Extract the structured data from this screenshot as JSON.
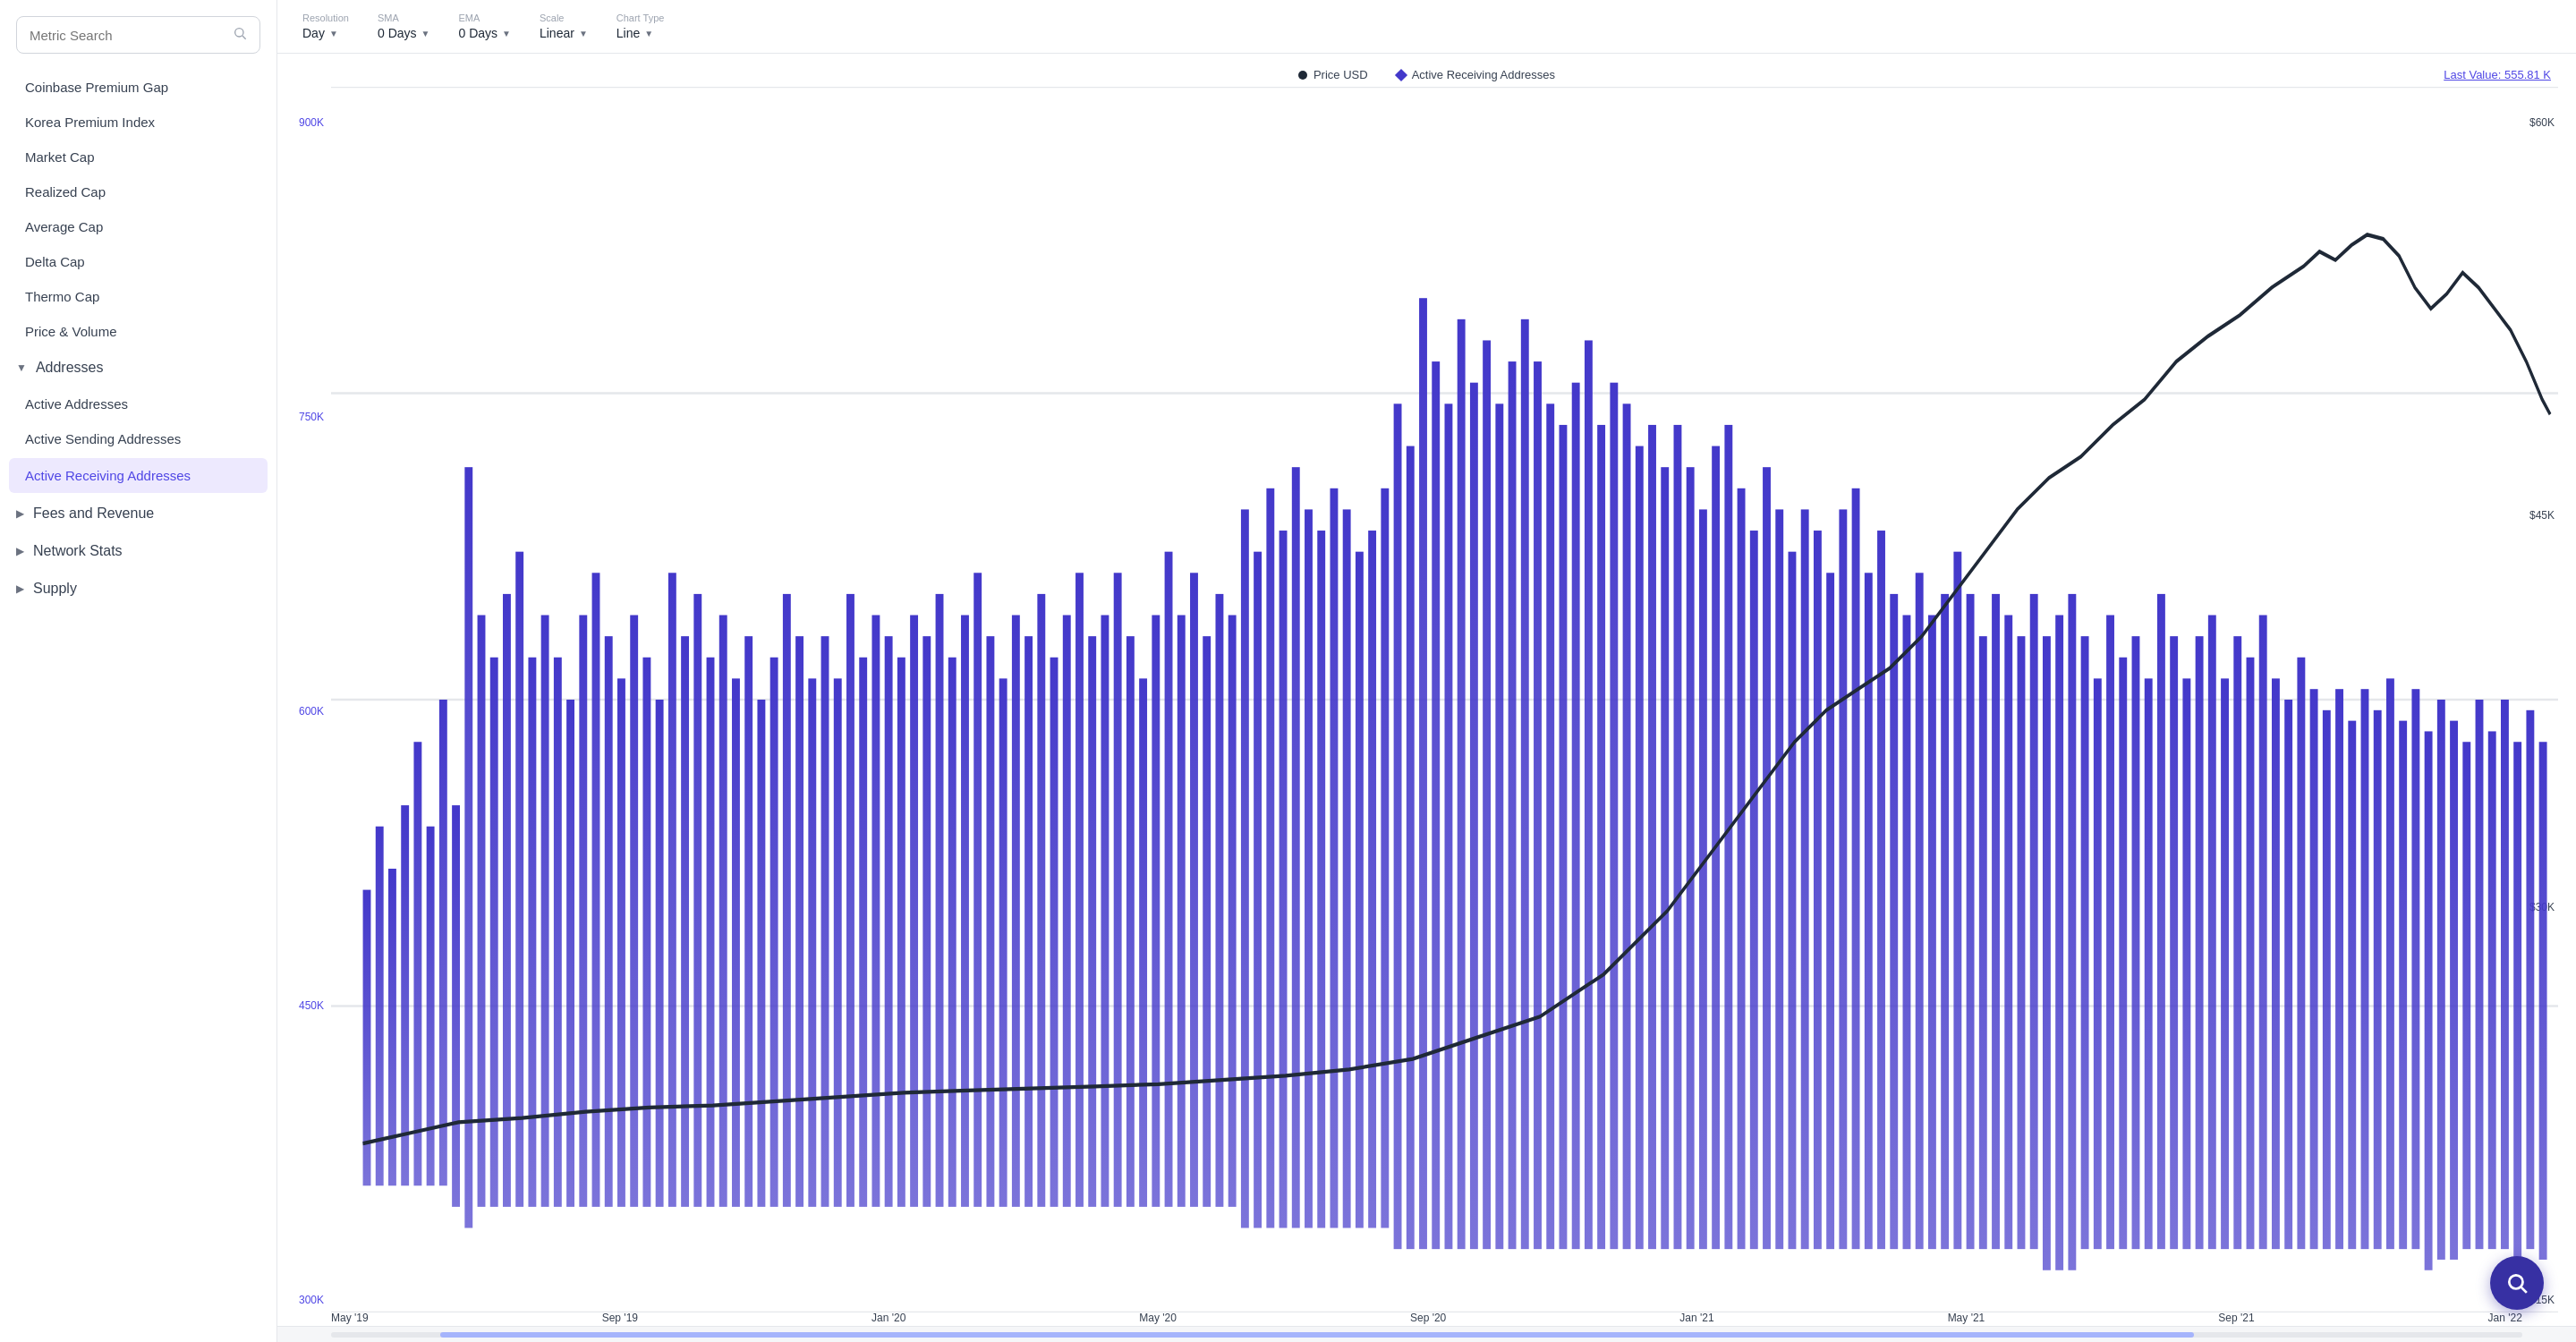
{
  "sidebar": {
    "search_placeholder": "Metric Search",
    "nav_items": [
      {
        "label": "Coinbase Premium Gap",
        "id": "coinbase-premium-gap"
      },
      {
        "label": "Korea Premium Index",
        "id": "korea-premium-index"
      },
      {
        "label": "Market Cap",
        "id": "market-cap"
      },
      {
        "label": "Realized Cap",
        "id": "realized-cap"
      },
      {
        "label": "Average Cap",
        "id": "average-cap"
      },
      {
        "label": "Delta Cap",
        "id": "delta-cap"
      },
      {
        "label": "Thermo Cap",
        "id": "thermo-cap"
      },
      {
        "label": "Price & Volume",
        "id": "price-volume"
      }
    ],
    "sections": [
      {
        "label": "Addresses",
        "id": "addresses",
        "expanded": true,
        "children": [
          {
            "label": "Active Addresses",
            "id": "active-addresses",
            "active": false
          },
          {
            "label": "Active Sending Addresses",
            "id": "active-sending-addresses",
            "active": false
          },
          {
            "label": "Active Receiving Addresses",
            "id": "active-receiving-addresses",
            "active": true
          }
        ]
      },
      {
        "label": "Fees and Revenue",
        "id": "fees-and-revenue",
        "expanded": false,
        "children": []
      },
      {
        "label": "Network Stats",
        "id": "network-stats",
        "expanded": false,
        "children": []
      },
      {
        "label": "Supply",
        "id": "supply",
        "expanded": false,
        "children": []
      }
    ]
  },
  "toolbar": {
    "resolution_label": "Resolution",
    "resolution_value": "Day",
    "sma_label": "SMA",
    "sma_value": "0 Days",
    "ema_label": "EMA",
    "ema_value": "0 Days",
    "scale_label": "Scale",
    "scale_value": "Linear",
    "chart_type_label": "Chart Type",
    "chart_type_value": "Line"
  },
  "chart": {
    "title": "Active Receiving Addresses",
    "legend": {
      "price_label": "Price USD",
      "metric_label": "Active Receiving Addresses",
      "last_value": "Last Value: 555.81 K"
    },
    "y_axis_left": [
      "900K",
      "750K",
      "600K",
      "450K",
      "300K"
    ],
    "y_axis_right": [
      "$60K",
      "$45K",
      "$30K",
      "$15K"
    ],
    "x_axis": [
      "May '19",
      "Sep '19",
      "Jan '20",
      "May '20",
      "Sep '20",
      "Jan '21",
      "May '21",
      "Sep '21",
      "Jan '22"
    ]
  },
  "float_button": {
    "label": "Search"
  },
  "colors": {
    "accent_blue": "#4338ca",
    "accent_purple": "#3730a3",
    "active_bg": "#ede9fe",
    "active_text": "#4f46e5"
  }
}
